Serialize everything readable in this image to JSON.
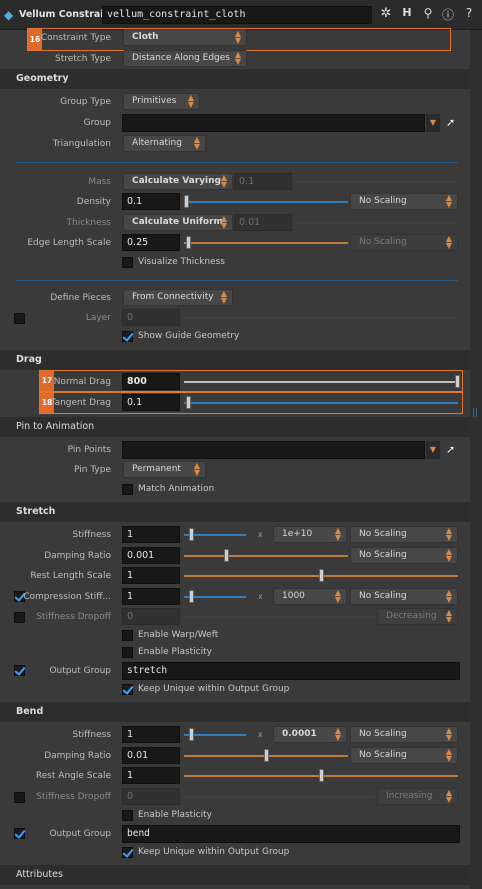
{
  "header": {
    "node_type": "Vellum Constraints",
    "node_name": "vellum_constraint_cloth"
  },
  "top": {
    "constraint_type_label": "Constraint Type",
    "constraint_type": "Cloth",
    "stretch_type_label": "Stretch Type",
    "stretch_type": "Distance Along Edges"
  },
  "badges": {
    "b16": "16",
    "b17": "17",
    "b18": "18"
  },
  "geometry": {
    "title": "Geometry",
    "group_type_label": "Group Type",
    "group_type": "Primitives",
    "group_label": "Group",
    "group_value": "",
    "triangulation_label": "Triangulation",
    "triangulation": "Alternating",
    "mass_label": "Mass",
    "mass_mode": "Calculate Varying",
    "mass_value": "0.1",
    "density_label": "Density",
    "density_value": "0.1",
    "density_scaling": "No Scaling",
    "thickness_label": "Thickness",
    "thickness_mode": "Calculate Uniform",
    "thickness_value": "0.01",
    "edge_length_scale_label": "Edge Length Scale",
    "edge_length_scale_value": "0.25",
    "edge_length_scale_scaling": "No Scaling",
    "visualize_thickness": "Visualize Thickness",
    "define_pieces_label": "Define Pieces",
    "define_pieces": "From Connectivity",
    "layer_label": "Layer",
    "layer_value": "0",
    "show_guide": "Show Guide Geometry"
  },
  "drag": {
    "title": "Drag",
    "normal_label": "Normal Drag",
    "normal_value": "800",
    "normal_level": 1.0,
    "tangent_label": "Tangent Drag",
    "tangent_value": "0.1",
    "tangent_level": 0.0
  },
  "pin": {
    "title": "Pin to Animation",
    "pin_points_label": "Pin Points",
    "pin_points_value": "",
    "pin_type_label": "Pin Type",
    "pin_type": "Permanent",
    "match_animation": "Match Animation"
  },
  "stretch": {
    "title": "Stretch",
    "stiffness_label": "Stiffness",
    "stiffness_value": "1",
    "stiffness_mult": "1e+10",
    "stiffness_scaling": "No Scaling",
    "damping_label": "Damping Ratio",
    "damping_value": "0.001",
    "damping_scaling": "No Scaling",
    "rest_length_label": "Rest Length Scale",
    "rest_length_value": "1",
    "compression_label": "Compression Stiff...",
    "compression_value": "1",
    "compression_mult": "1000",
    "compression_scaling": "No Scaling",
    "dropoff_label": "Stiffness Dropoff",
    "dropoff_value": "0",
    "dropoff_mode": "Decreasing",
    "warp_weft": "Enable Warp/Weft",
    "plasticity": "Enable Plasticity",
    "output_group_label": "Output Group",
    "output_group_value": "stretch",
    "keep_unique": "Keep Unique within Output Group"
  },
  "bend": {
    "title": "Bend",
    "stiffness_label": "Stiffness",
    "stiffness_value": "1",
    "stiffness_mult": "0.0001",
    "stiffness_scaling": "No Scaling",
    "damping_label": "Damping Ratio",
    "damping_value": "0.01",
    "damping_scaling": "No Scaling",
    "rest_angle_label": "Rest Angle Scale",
    "rest_angle_value": "1",
    "dropoff_label": "Stiffness Dropoff",
    "dropoff_value": "0",
    "dropoff_mode": "Increasing",
    "plasticity": "Enable Plasticity",
    "output_group_label": "Output Group",
    "output_group_value": "bend",
    "keep_unique": "Keep Unique within Output Group"
  },
  "attributes": {
    "title": "Attributes"
  },
  "x_sign": "x",
  "colors": {
    "accent_orange": "#e0782f",
    "slider_blue": "#2f7fc0",
    "slider_orange": "#c07a3a",
    "check_blue": "#3aa0ff"
  }
}
